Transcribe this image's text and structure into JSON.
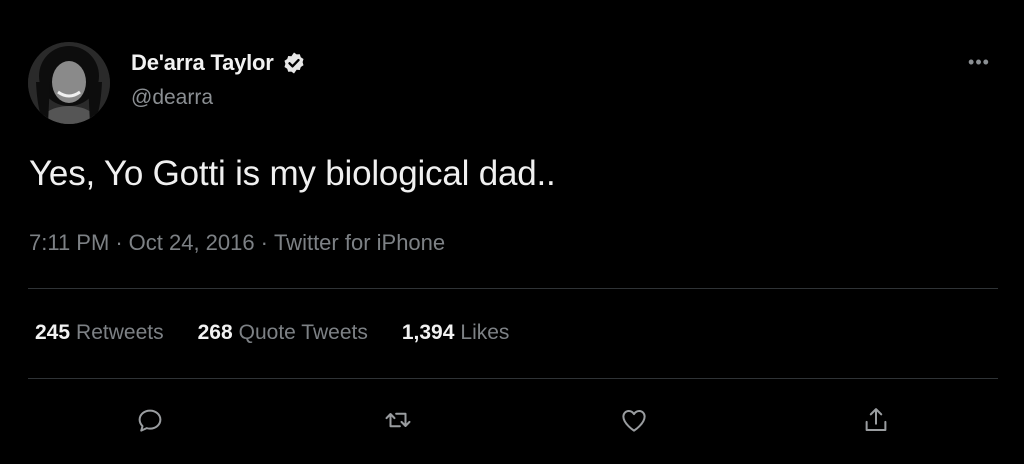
{
  "author": {
    "display_name": "De'arra Taylor",
    "handle": "@dearra",
    "verified_icon": "verified-badge-icon"
  },
  "menu": {
    "more_label": "•••"
  },
  "tweet": {
    "text": "Yes, Yo Gotti is my biological dad..",
    "time": "7:11 PM",
    "date": "Oct 24, 2016",
    "source": "Twitter for iPhone",
    "separator": "·"
  },
  "stats": {
    "retweets_count": "245",
    "retweets_label": "Retweets",
    "quotes_count": "268",
    "quotes_label": "Quote Tweets",
    "likes_count": "1,394",
    "likes_label": "Likes"
  },
  "actions": [
    "reply-icon",
    "retweet-icon",
    "like-icon",
    "share-icon"
  ],
  "colors": {
    "background": "#000000",
    "text": "#f0f0f0",
    "secondary": "#7d8185",
    "divider": "#2f3336"
  }
}
